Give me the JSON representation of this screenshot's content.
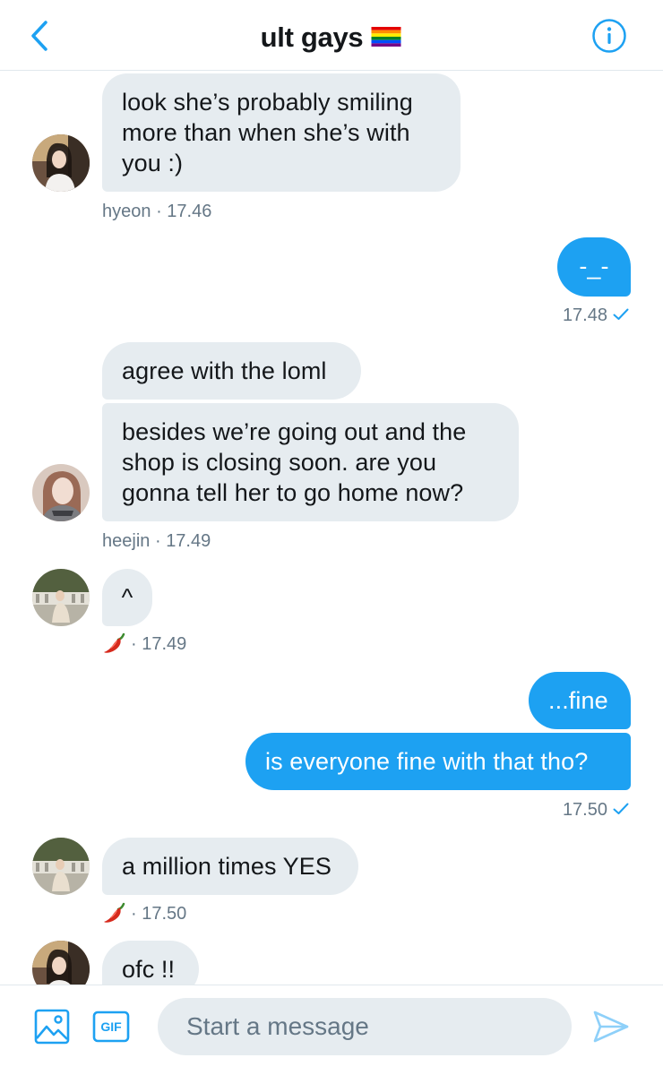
{
  "header": {
    "title": "ult gays",
    "flag_icon": "rainbow-flag-icon",
    "back_icon": "chevron-left-icon",
    "info_icon": "info-icon"
  },
  "messages": [
    {
      "direction": "in",
      "text": "look she’s probably smiling more than when she’s with you :)"
    },
    {
      "direction": "meta",
      "sender": "hyeon",
      "sep": "·",
      "time": "17.46"
    },
    {
      "direction": "out",
      "text": "-_-"
    },
    {
      "direction": "meta",
      "time": "17.48",
      "status_icon": "checkmark-icon"
    },
    {
      "direction": "in",
      "text": "agree with the loml"
    },
    {
      "direction": "in",
      "text": "besides we’re going out and the shop is closing soon. are you gonna tell her to go home now?"
    },
    {
      "direction": "meta",
      "sender": "heejin",
      "sep": "·",
      "time": "17.49"
    },
    {
      "direction": "in",
      "text": "^"
    },
    {
      "direction": "meta",
      "sender_icon": "chili-pepper-icon",
      "sep": "·",
      "time": "17.49"
    },
    {
      "direction": "out",
      "text": "...fine"
    },
    {
      "direction": "out",
      "text": "is everyone fine with that tho?"
    },
    {
      "direction": "meta",
      "time": "17.50",
      "status_icon": "checkmark-icon"
    },
    {
      "direction": "in",
      "text": "a million times YES"
    },
    {
      "direction": "meta",
      "sender_icon": "chili-pepper-icon",
      "sep": "·",
      "time": "17.50"
    },
    {
      "direction": "in",
      "text": "ofc !!"
    }
  ],
  "composer": {
    "placeholder": "Start a message",
    "media_icon": "image-icon",
    "gif_label": "GIF",
    "send_icon": "send-icon"
  },
  "colors": {
    "accent": "#1da1f2",
    "incoming_bubble": "#e6ecf0",
    "meta_text": "#657786",
    "divider": "#e1e8ed"
  }
}
